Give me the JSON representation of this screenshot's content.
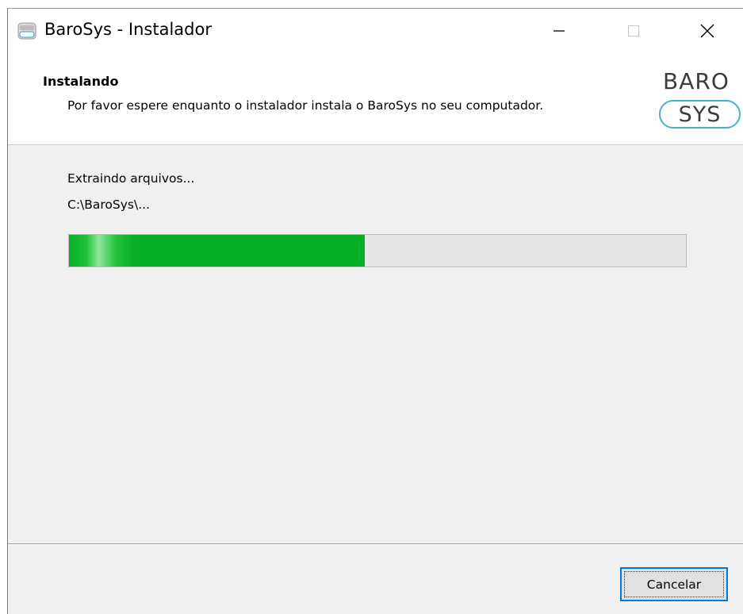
{
  "window": {
    "title": "BaroSys - Instalador",
    "icon": "barosys-app-icon"
  },
  "title_controls": {
    "minimize_icon": "minimize-icon",
    "maximize_icon": "maximize-icon",
    "close_icon": "close-icon"
  },
  "header": {
    "title": "Instalando",
    "description": "Por favor espere enquanto o instalador instala o BaroSys no seu computador.",
    "logo_top": "BARO",
    "logo_bottom": "SYS",
    "logo_accent_color": "#4ab3c9"
  },
  "body": {
    "status_text": "Extraindo arquivos...",
    "path_text": "C:\\BaroSys\\...",
    "progress_fraction": 0.48,
    "progress_color": "#06b025"
  },
  "footer": {
    "cancel_label": "Cancelar"
  }
}
